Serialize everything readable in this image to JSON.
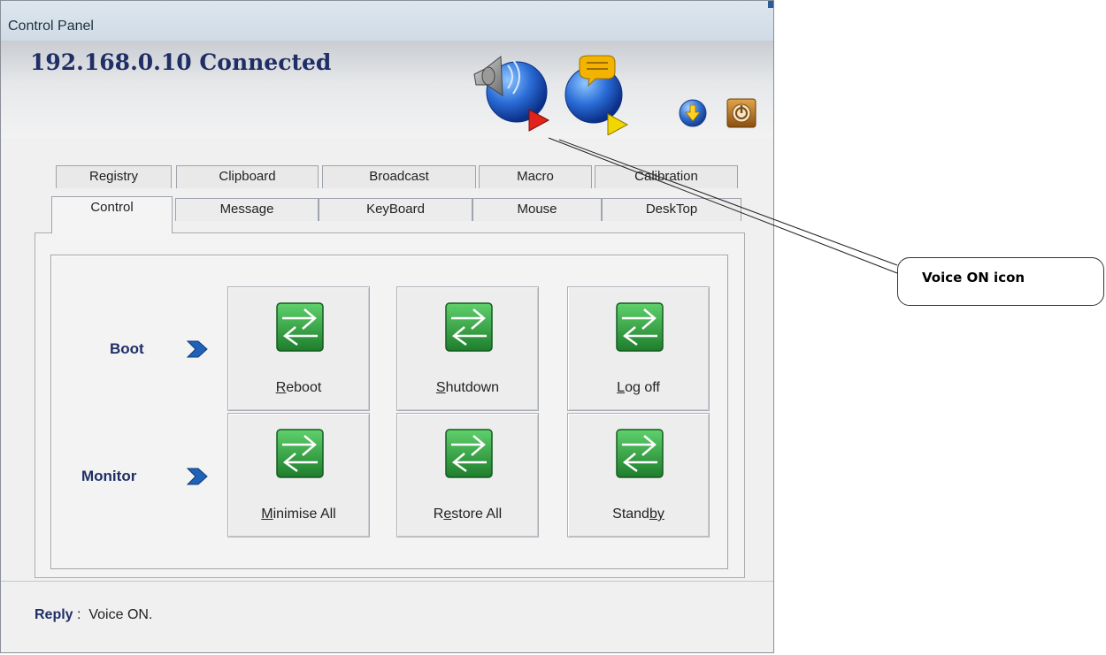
{
  "window": {
    "title": "Control Panel",
    "status": "192.168.0.10 Connected"
  },
  "header_icons": [
    {
      "name": "voice-on-icon",
      "color": "#1b4fb3",
      "arrow_color": "#e0231b"
    },
    {
      "name": "message-broadcast-icon",
      "color": "#1b4fb3",
      "arrow_color": "#f2d600"
    },
    {
      "name": "download-icon",
      "color": "#2e6fd0"
    },
    {
      "name": "power-icon",
      "color": "#b5721c"
    }
  ],
  "tabs": {
    "back_row": [
      "Registry",
      "Clipboard",
      "Broadcast",
      "Macro",
      "Calibration"
    ],
    "front_row": [
      "Control",
      "Message",
      "KeyBoard",
      "Mouse",
      "DeskTop"
    ],
    "active": "Control"
  },
  "control": {
    "rows": [
      {
        "label": "Boot",
        "buttons": [
          {
            "pre": "",
            "u": "R",
            "post": "eboot"
          },
          {
            "pre": "",
            "u": "S",
            "post": "hutdown"
          },
          {
            "pre": "",
            "u": "L",
            "post": "og off"
          }
        ]
      },
      {
        "label": "Monitor",
        "buttons": [
          {
            "pre": "",
            "u": "M",
            "post": "inimise All"
          },
          {
            "pre": "R",
            "u": "e",
            "post": "store All"
          },
          {
            "pre": "Stand",
            "u": "by",
            "post": ""
          }
        ]
      }
    ]
  },
  "reply": {
    "label": "Reply",
    "separator": " :  ",
    "text": "Voice ON."
  },
  "callout": {
    "text": "Voice ON icon"
  },
  "colors": {
    "accent_navy": "#1f2f66",
    "button_green": "#2e9b3c"
  }
}
